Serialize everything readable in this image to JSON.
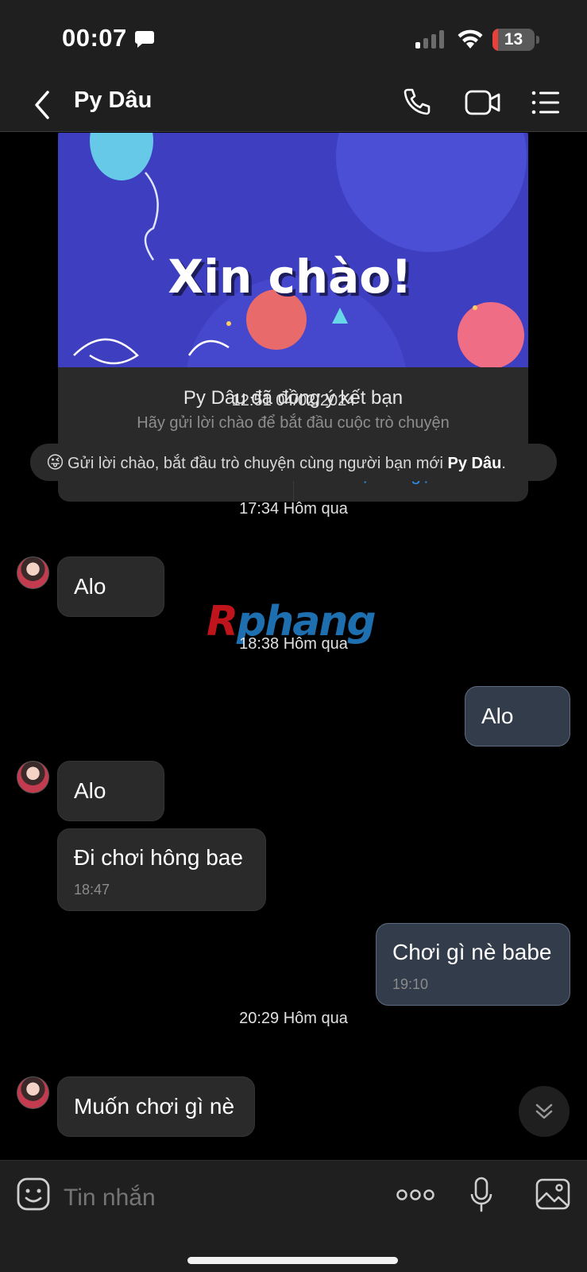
{
  "status_bar": {
    "time": "00:07",
    "battery_level": "13",
    "battery_fraction": 0.13,
    "battery_color": "#e8403a"
  },
  "header": {
    "contact_name": "Py Dâu",
    "icons": [
      "back-icon",
      "phone-icon",
      "video-call-icon",
      "menu-list-icon"
    ]
  },
  "welcome_card": {
    "banner_text": "Xin chào!",
    "title": "Py Dâu đã đồng ý kết bạn",
    "subtitle": "Hãy gửi lời chào để bắt đầu cuộc trò chuyện",
    "button_greet": "Gửi lời chào",
    "button_nickname": "Đặt tên gợi nhớ"
  },
  "hint": {
    "emoji": "😜",
    "text": "Gửi lời chào, bắt đầu trò chuyện cùng người bạn mới ",
    "name": "Py Dâu",
    "suffix": "."
  },
  "timestamps": {
    "t1": "12:51 04/02/2024",
    "t2": "17:34 Hôm qua",
    "t3": "18:38 Hôm qua",
    "t4": "20:29 Hôm qua"
  },
  "messages": [
    {
      "direction": "in",
      "text": "Alo"
    },
    {
      "direction": "out",
      "text": "Alo"
    },
    {
      "direction": "in",
      "text": "Alo"
    },
    {
      "direction": "in",
      "text": "Đi chơi hông bae",
      "time": "18:47"
    },
    {
      "direction": "out",
      "text": "Chơi gì nè babe",
      "time": "19:10"
    },
    {
      "direction": "in",
      "text": "Muốn chơi gì nè"
    }
  ],
  "watermark": "Rphang",
  "input": {
    "placeholder": "Tin nhắn",
    "value": ""
  },
  "colors": {
    "accent": "#2e8ff0",
    "outgoing_bubble": "#333c4a",
    "incoming_bubble": "#2a2a2a"
  }
}
